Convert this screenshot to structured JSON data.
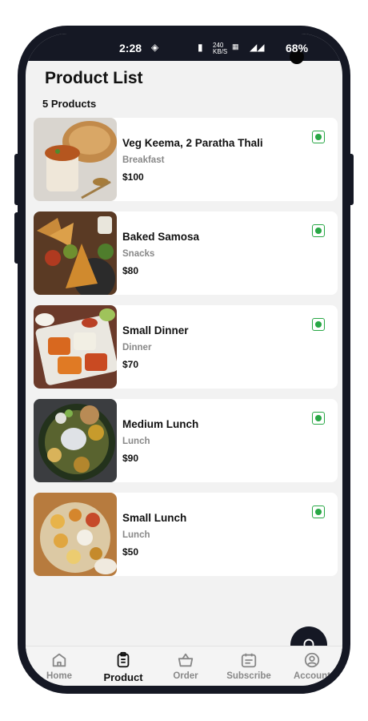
{
  "status_bar": {
    "time": "2:28",
    "network": "240 KB/S",
    "battery": "68%"
  },
  "header": {
    "title": "Product List",
    "count": "5 Products"
  },
  "products": [
    {
      "name": "Veg Keema, 2 Paratha Thali",
      "category": "Breakfast",
      "price": "$100"
    },
    {
      "name": "Baked Samosa",
      "category": "Snacks",
      "price": "$80"
    },
    {
      "name": "Small Dinner",
      "category": "Dinner",
      "price": "$70"
    },
    {
      "name": "Medium Lunch",
      "category": "Lunch",
      "price": "$90"
    },
    {
      "name": "Small Lunch",
      "category": "Lunch",
      "price": "$50"
    }
  ],
  "nav": [
    {
      "label": "Home",
      "icon": "home-icon"
    },
    {
      "label": "Product",
      "icon": "clipboard-icon"
    },
    {
      "label": "Order",
      "icon": "basket-icon"
    },
    {
      "label": "Subscribe",
      "icon": "calendar-icon"
    },
    {
      "label": "Account",
      "icon": "user-circle-icon"
    }
  ],
  "colors": {
    "dark": "#151824",
    "veg_green": "#28a745",
    "background": "#f2f2f2"
  }
}
